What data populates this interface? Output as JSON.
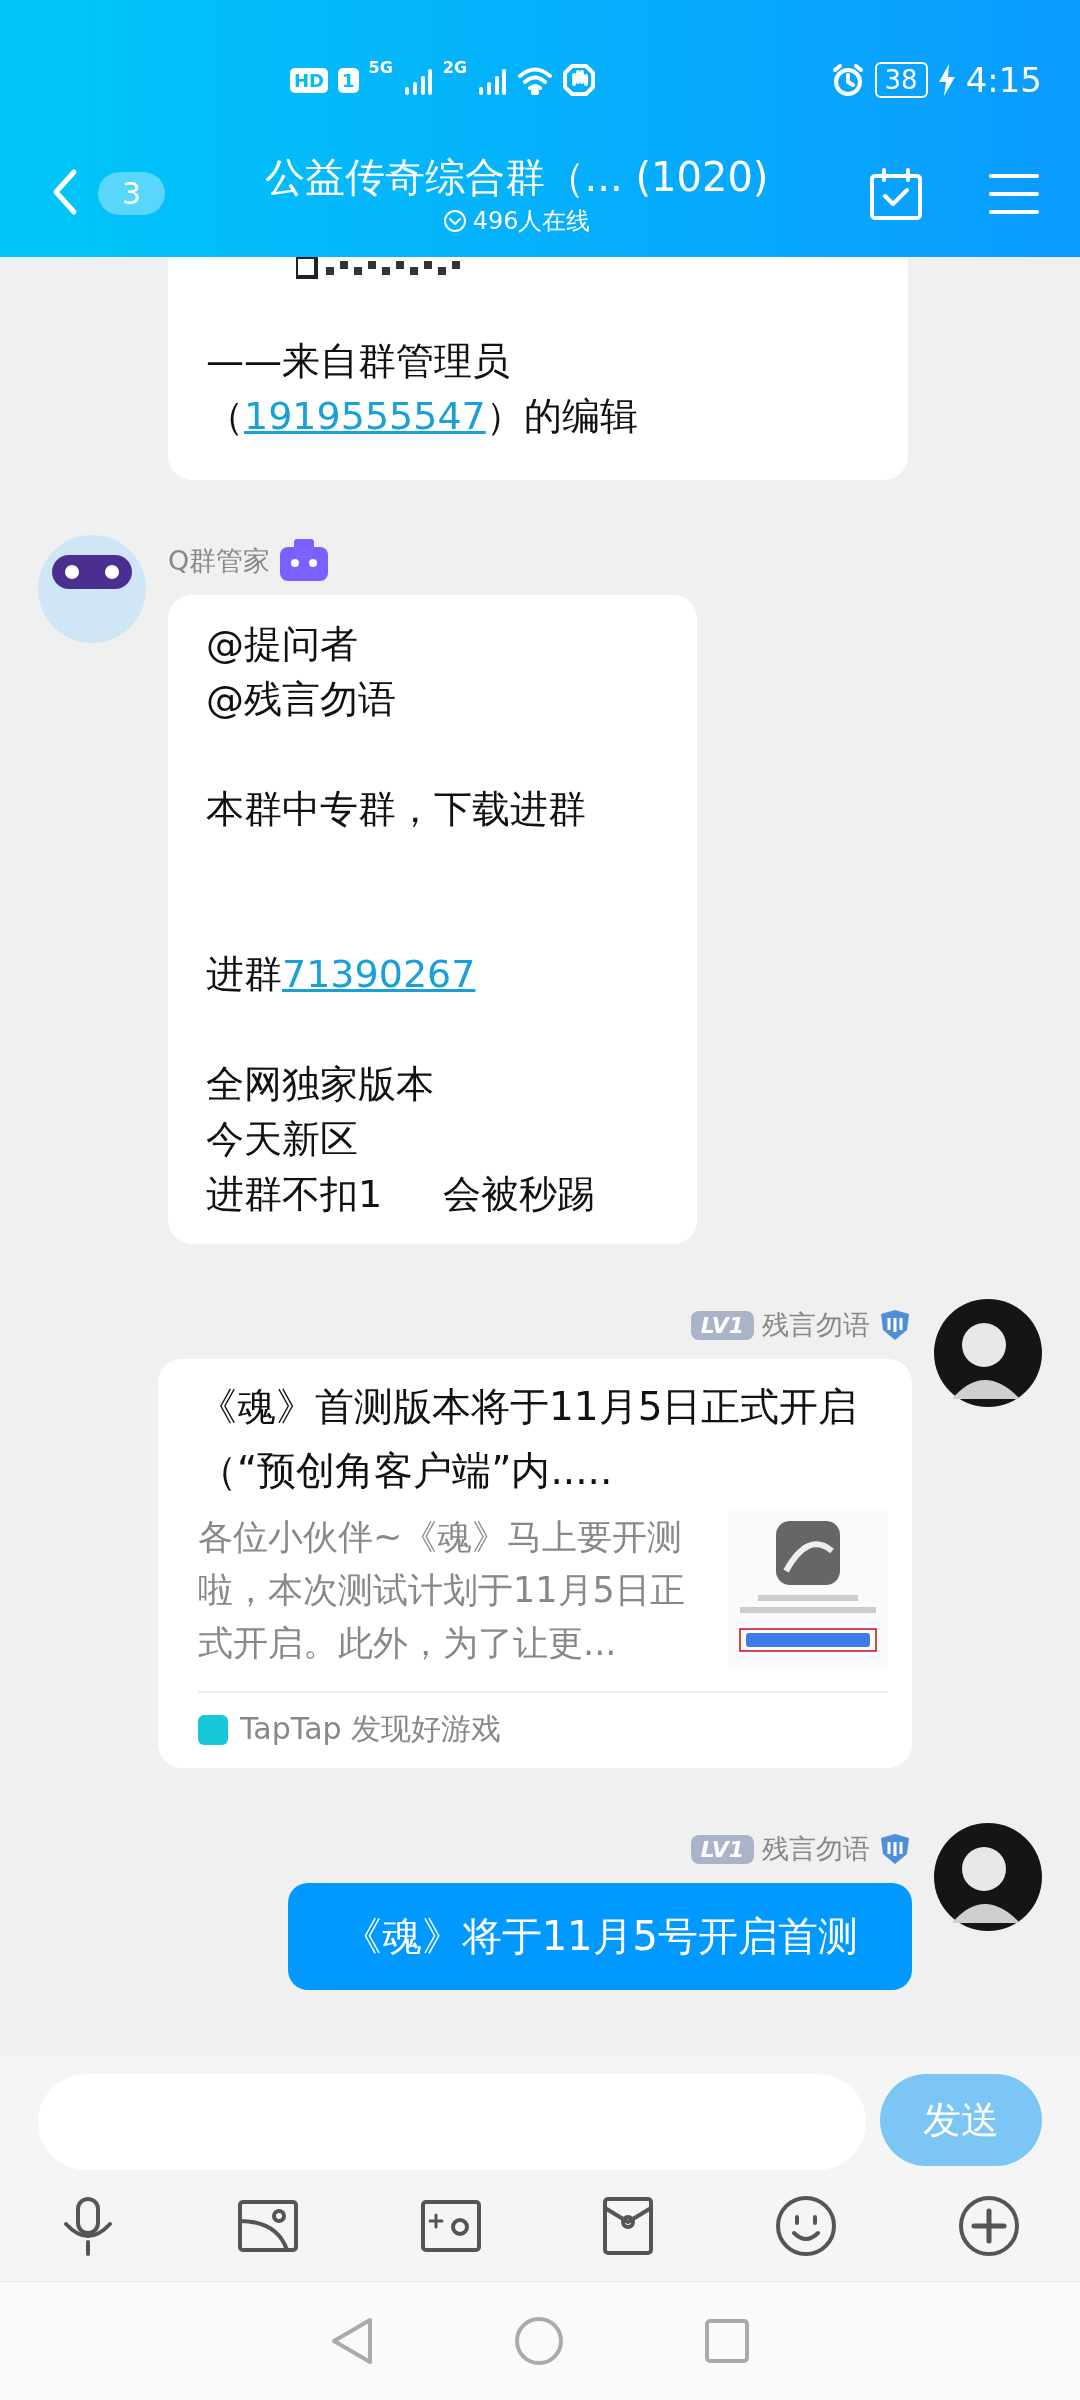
{
  "status_bar": {
    "hd": "HD",
    "sim": "1",
    "signal_1": "5G",
    "signal_2": "2G",
    "battery": "38",
    "time": "4:15"
  },
  "header": {
    "unread": "3",
    "title": "公益传奇综合群（... (1020)",
    "online": "496人在线"
  },
  "messages": [
    {
      "kind": "partial",
      "paragraphs": [
        {
          "kind": "normal",
          "lines": [
            [
              {
                "kind": "text",
                "text": "——来自群管理员"
              }
            ],
            [
              {
                "kind": "text",
                "text": "（"
              },
              {
                "kind": "link",
                "text": "1919555547"
              },
              {
                "kind": "text",
                "text": "）的编辑"
              }
            ]
          ]
        }
      ]
    },
    {
      "kind": "incoming_text",
      "sender": {
        "name": "Q群管家"
      },
      "paragraphs": [
        {
          "kind": "normal",
          "lines": [
            [
              {
                "kind": "text",
                "text": "@提问者"
              }
            ],
            [
              {
                "kind": "text",
                "text": "@残言勿语"
              }
            ]
          ]
        },
        {
          "kind": "normal",
          "lines": [
            [
              {
                "kind": "text",
                "text": "本群中专群，下载进群"
              }
            ]
          ]
        },
        {
          "kind": "wide",
          "lines": [
            [
              {
                "kind": "text",
                "text": "进群"
              },
              {
                "kind": "link",
                "text": "71390267"
              }
            ]
          ]
        },
        {
          "kind": "normal",
          "lines": [
            [
              {
                "kind": "text",
                "text": "全网独家版本"
              }
            ],
            [
              {
                "kind": "text",
                "text": "今天新区"
              }
            ],
            [
              {
                "kind": "text",
                "text": "进群不扣1     会被秒踢"
              }
            ]
          ]
        }
      ]
    },
    {
      "kind": "outgoing_card",
      "sender": {
        "level": "LV1",
        "name": "残言勿语"
      },
      "card": {
        "title": "《魂》首测版本将于11月5日正式开启（“预创角客户端”内.....",
        "description": "各位小伙伴~《魂》马上要开测啦，本次测试计划于11月5日正式开启。此外，为了让更...",
        "source": "TapTap 发现好游戏"
      }
    },
    {
      "kind": "outgoing_text",
      "sender": {
        "level": "LV1",
        "name": "残言勿语"
      },
      "text": "《魂》将于11月5号开启首测"
    }
  ],
  "composer": {
    "send": "发送"
  }
}
